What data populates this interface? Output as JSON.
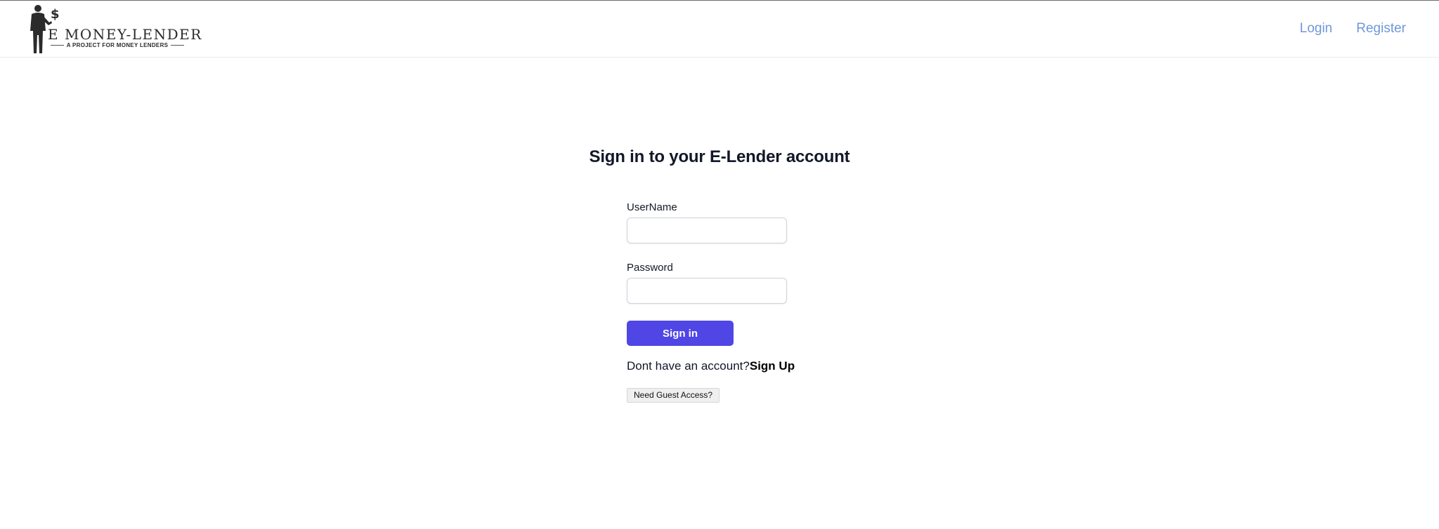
{
  "header": {
    "logo": {
      "title": "E MONEY-LENDER",
      "subtitle": "A PROJECT FOR MONEY LENDERS",
      "icon": "businessman-dollar-icon"
    },
    "nav": {
      "login_label": "Login",
      "register_label": "Register"
    }
  },
  "main": {
    "title": "Sign in to your E-Lender account",
    "username": {
      "label": "UserName",
      "value": "",
      "placeholder": ""
    },
    "password": {
      "label": "Password",
      "value": "",
      "placeholder": ""
    },
    "signin_label": "Sign in",
    "signup_prompt": "Dont have an account?",
    "signup_link": "Sign Up",
    "guest_label": "Need Guest Access?"
  },
  "colors": {
    "accent": "#4f46e5",
    "nav_link": "#6f97dc",
    "text": "#111827"
  }
}
